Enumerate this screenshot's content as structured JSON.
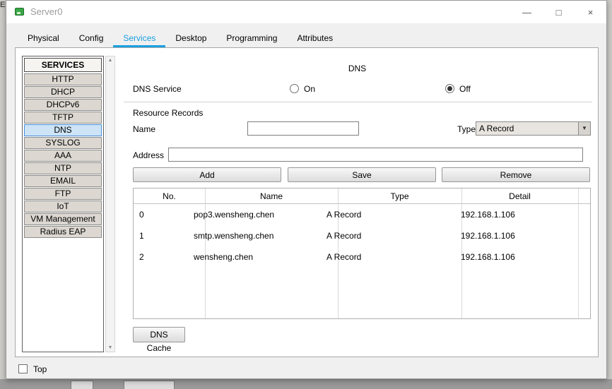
{
  "background": {
    "top_left_text": "Et"
  },
  "window": {
    "title": "Server0",
    "minimize_label": "—",
    "maximize_label": "□",
    "close_label": "×"
  },
  "tabs": [
    {
      "label": "Physical"
    },
    {
      "label": "Config"
    },
    {
      "label": "Services"
    },
    {
      "label": "Desktop"
    },
    {
      "label": "Programming"
    },
    {
      "label": "Attributes"
    }
  ],
  "sidebar": {
    "header": "SERVICES",
    "items": [
      {
        "label": "HTTP"
      },
      {
        "label": "DHCP"
      },
      {
        "label": "DHCPv6"
      },
      {
        "label": "TFTP"
      },
      {
        "label": "DNS",
        "active": true
      },
      {
        "label": "SYSLOG"
      },
      {
        "label": "AAA"
      },
      {
        "label": "NTP"
      },
      {
        "label": "EMAIL"
      },
      {
        "label": "FTP"
      },
      {
        "label": "IoT"
      },
      {
        "label": "VM Management"
      },
      {
        "label": "Radius EAP"
      }
    ]
  },
  "dns": {
    "title": "DNS",
    "service_label": "DNS Service",
    "on_label": "On",
    "off_label": "Off",
    "selected_state": "Off",
    "resource_records_label": "Resource Records",
    "name_label": "Name",
    "name_value": "",
    "type_label": "Type",
    "type_value": "A Record",
    "address_label": "Address",
    "address_value": "",
    "add_button": "Add",
    "save_button": "Save",
    "remove_button": "Remove",
    "dns_cache_button": "DNS Cache",
    "table": {
      "headers": [
        "No.",
        "Name",
        "Type",
        "Detail"
      ],
      "rows": [
        {
          "no": "0",
          "name": "pop3.wensheng.chen",
          "type": "A Record",
          "detail": "192.168.1.106"
        },
        {
          "no": "1",
          "name": "smtp.wensheng.chen",
          "type": "A Record",
          "detail": "192.168.1.106"
        },
        {
          "no": "2",
          "name": "wensheng.chen",
          "type": "A Record",
          "detail": "192.168.1.106"
        }
      ]
    }
  },
  "footer": {
    "top_label": "Top"
  },
  "colors": {
    "accent_blue": "#1ba1e2",
    "selected_item_bg": "#cde4f7",
    "selected_item_border": "#4a90d9"
  }
}
